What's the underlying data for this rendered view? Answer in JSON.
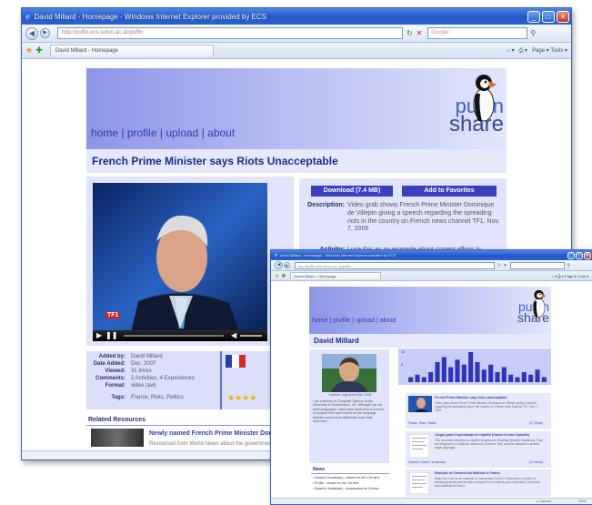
{
  "back_window": {
    "title": "David Millard - Homepage - Windows Internet Explorer provided by ECS",
    "address": "http://puffin.ecs.soton.ac.uk/puffin",
    "search_placeholder": "Google",
    "tab_label": "David Millard - Homepage",
    "commands": "Page ▾ Tools ▾",
    "nav": [
      "home",
      "profile",
      "upload",
      "about"
    ],
    "logo_top": "puffin",
    "logo_bottom": "share",
    "headline": "French Prime Minister says Riots Unacceptable",
    "download_btn": "Download (7.4 MB)",
    "favorites_btn": "Add to Favorites",
    "desc_label": "Description:",
    "desc_text": "Video grab shows French Prime Minister Dominique de Villepin giving a speech regarding the spreading riots in the country on French news channel TF1. Nov. 7, 2005",
    "activity_label": "Activity:",
    "activity_text": "I use this as an example about current affairs in",
    "tv_logo": "TF1",
    "meta_labels": [
      "Added by:",
      "Date Added:",
      "Viewed:",
      "Comments:",
      "Format:",
      "Tags:"
    ],
    "meta_values": [
      "David Millard",
      "Dec. 2007",
      "31 times",
      "2 Activities, 4 Experiences",
      "video (avi)",
      "France, Riots, Politics"
    ],
    "related_heading": "Related Resources",
    "related_item": "Newly named French Prime Minister Dominique",
    "related_sub": "Resourced from World News about the government"
  },
  "front_window": {
    "title": "David Millard - Homepage - Windows Internet Explorer provided by ECS",
    "address": "http://puffin.ecs.soton.ac.uk/puffin",
    "tab_label": "David Millard - Homepage",
    "commands": "Page ▾ Tools ▾",
    "nav": [
      "home",
      "profile",
      "upload",
      "about"
    ],
    "logo_top": "puffin",
    "logo_bottom": "share",
    "page_title": "David Millard",
    "photo_caption": "Lecturer, registered Mar. 2006",
    "bio": "I am a lecturer of Computer Science at the University of Southampton, UK. Although I do not teach languages I have been involved in a number of projects that have looked at how language teachers could more effectively share their resources.",
    "news_heading": "News",
    "news_items": [
      "Spanish Vocabulary - viewed for the 17th time",
      "Profile - viewed for the 7th time",
      "Spanish Vocabulary - downloaded for 8 times"
    ],
    "chart_bars": [
      2,
      3,
      2,
      4,
      8,
      10,
      6,
      9,
      7,
      12,
      8,
      5,
      7,
      4,
      6,
      3,
      2,
      4,
      3,
      5,
      2
    ],
    "chart_axis_top": "10",
    "chart_axis_mid": "5",
    "resources": [
      {
        "title": "French Prime Minister says riots unacceptable",
        "desc": "Video grab shows French Prime Minister Dominique de Villepin giving a speech regarding the spreading riots in the country on French news channel TF1. Nov. 7, 2005",
        "tags": "France, Riots, Politics",
        "count": "(27 Views)"
      },
      {
        "title": "Juegos para el aprendizaje de español (Games to learn Spanish)",
        "desc": "This document describes a number of games for teaching Spanish Vocabulary. They are designed for a Spanish classroom, however, they could be adapted to another target language.",
        "tags": "Spanish, Games, Vocabulary",
        "count": "(20 Views)"
      },
      {
        "title": "Example of Commercial Material in France",
        "desc": "Plain Text I use as an example of Commercial French. It describes a number of existing products and includes example text as training and vocabulary. Download free materials in French.",
        "tags": "",
        "count": ""
      }
    ],
    "status_zone": "Internet",
    "status_zoom": "100%"
  }
}
